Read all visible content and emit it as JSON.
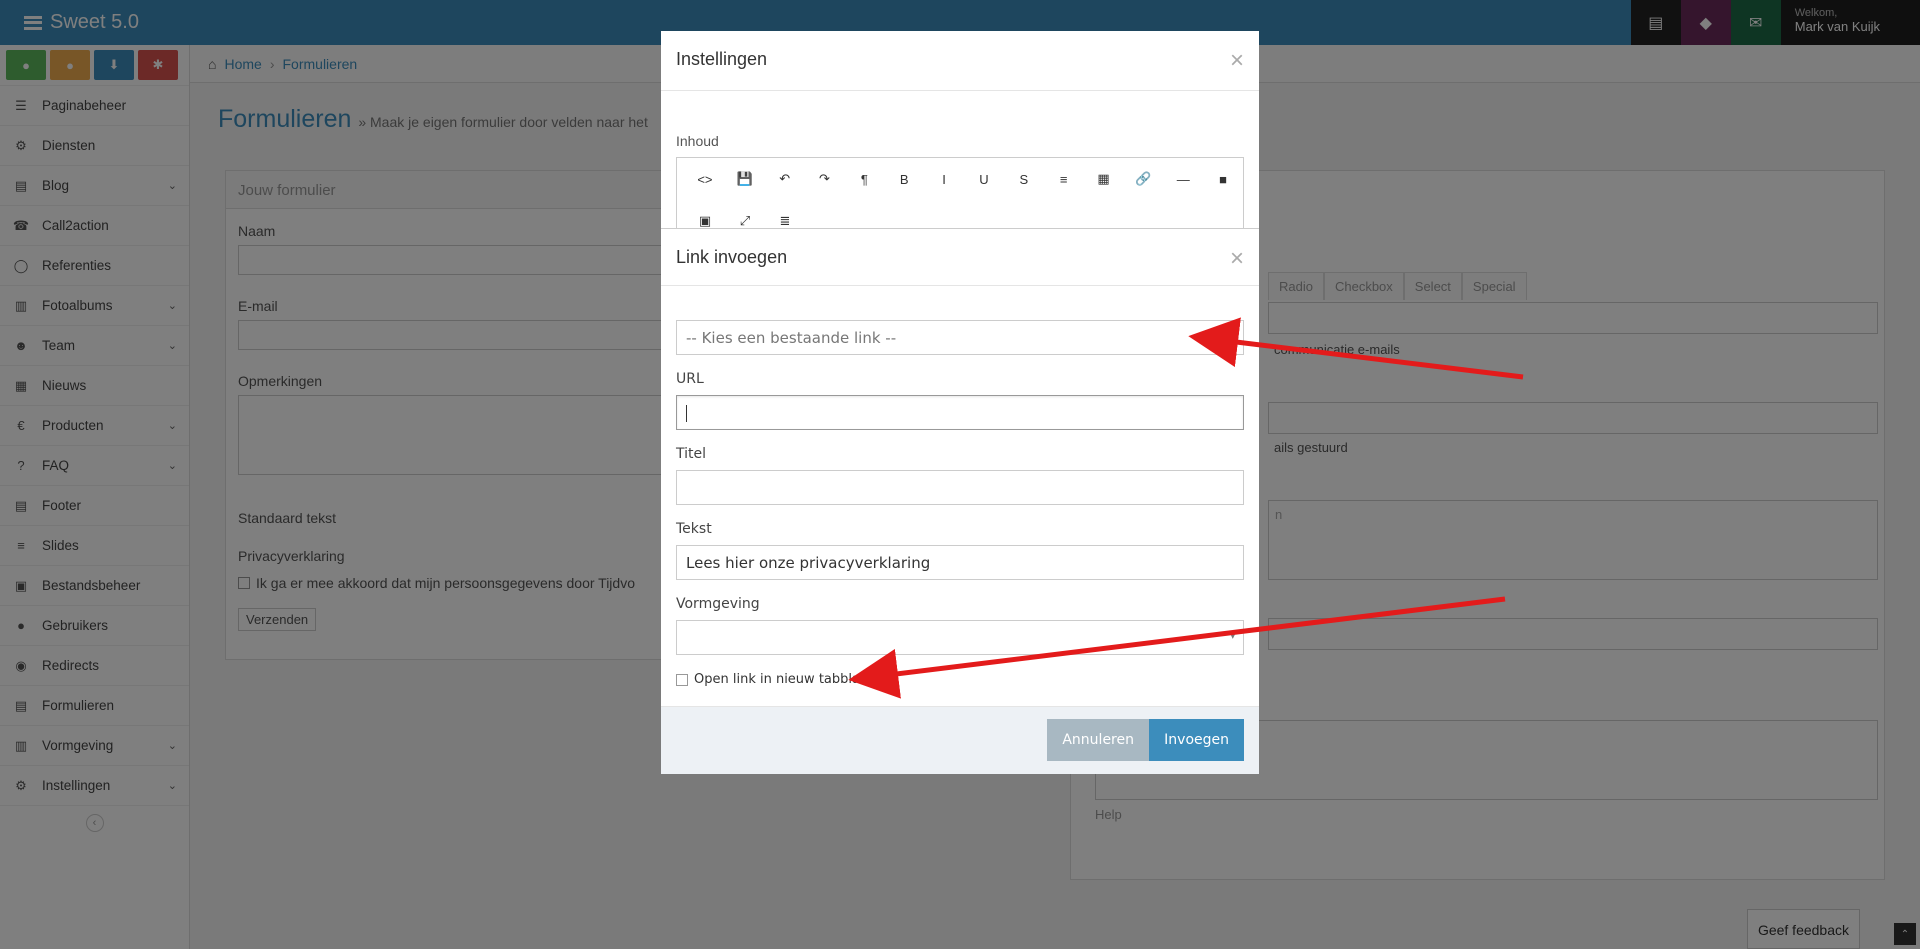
{
  "app": {
    "title": "Sweet 5.0"
  },
  "header": {
    "welcome": "Welkom,",
    "user_name": "Mark van Kuijk"
  },
  "sidebar": {
    "items": [
      {
        "label": "Paginabeheer",
        "icon": "bars-icon",
        "has_children": false
      },
      {
        "label": "Diensten",
        "icon": "cogs-icon",
        "has_children": false
      },
      {
        "label": "Blog",
        "icon": "file-icon",
        "has_children": true
      },
      {
        "label": "Call2action",
        "icon": "phone-icon",
        "has_children": false
      },
      {
        "label": "Referenties",
        "icon": "comment-icon",
        "has_children": false
      },
      {
        "label": "Fotoalbums",
        "icon": "book-icon",
        "has_children": true
      },
      {
        "label": "Team",
        "icon": "users-icon",
        "has_children": true
      },
      {
        "label": "Nieuws",
        "icon": "newspaper-icon",
        "has_children": false
      },
      {
        "label": "Producten",
        "icon": "euro-icon",
        "has_children": true
      },
      {
        "label": "FAQ",
        "icon": "question-icon",
        "has_children": true
      },
      {
        "label": "Footer",
        "icon": "list-icon",
        "has_children": false
      },
      {
        "label": "Slides",
        "icon": "sliders-icon",
        "has_children": false
      },
      {
        "label": "Bestandsbeheer",
        "icon": "image-icon",
        "has_children": false
      },
      {
        "label": "Gebruikers",
        "icon": "user-icon",
        "has_children": false
      },
      {
        "label": "Redirects",
        "icon": "circle-arrow-icon",
        "has_children": false
      },
      {
        "label": "Formulieren",
        "icon": "form-icon",
        "has_children": false
      },
      {
        "label": "Vormgeving",
        "icon": "layout-icon",
        "has_children": true
      },
      {
        "label": "Instellingen",
        "icon": "gear-icon",
        "has_children": true
      }
    ]
  },
  "breadcrumb": {
    "home": "Home",
    "current": "Formulieren"
  },
  "page": {
    "title": "Formulieren",
    "subtitle": "» Maak je eigen formulier door velden naar het"
  },
  "form_panel": {
    "title": "Jouw formulier",
    "fields": {
      "naam": "Naam",
      "email": "E-mail",
      "opmerkingen": "Opmerkingen",
      "standaard_tekst": "Standaard tekst",
      "privacy": "Privacyverklaring",
      "consent": "Ik ga er mee akkoord dat mijn persoonsgegevens door Tijdvo",
      "submit": "Verzenden"
    }
  },
  "right_panel": {
    "tabs": [
      "Radio",
      "Checkbox",
      "Select",
      "Special"
    ],
    "text_1": "communicatie e-mails",
    "text_2": "ails gestuurd",
    "text_3": "n",
    "help": "Help"
  },
  "feedback": {
    "label": "Geef feedback"
  },
  "settings_modal": {
    "title": "Instellingen",
    "content_label": "Inhoud",
    "toolbar_row1": [
      "<>",
      "💾",
      "↶",
      "↷",
      "¶",
      "B",
      "I",
      "U",
      "S",
      "≡",
      "▦",
      "🔗",
      "—",
      "■"
    ],
    "toolbar_row2": [
      "▣",
      "⤢",
      "≣"
    ]
  },
  "link_modal": {
    "title": "Link invoegen",
    "existing_link_placeholder": "-- Kies een bestaande link --",
    "url_label": "URL",
    "url_value": "",
    "title_label": "Titel",
    "title_value": "",
    "text_label": "Tekst",
    "text_value": "Lees hier onze privacyverklaring",
    "style_label": "Vormgeving",
    "style_value": "",
    "new_tab_label": "Open link in nieuw tabblad",
    "new_tab_checked": false,
    "cancel_label": "Annuleren",
    "insert_label": "Invoegen"
  },
  "colors": {
    "primary": "#3c8dbc",
    "arrow": "#e31b1b",
    "cancel": "#a8b8c2"
  }
}
